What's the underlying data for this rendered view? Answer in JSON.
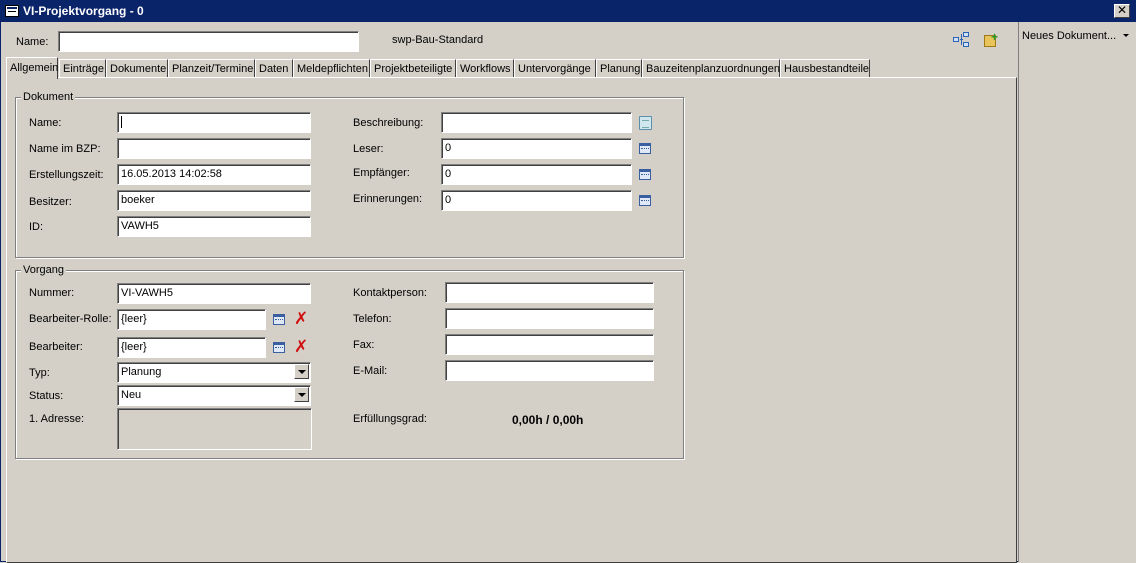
{
  "window": {
    "title": "VI-Projektvorgang - 0",
    "close_glyph": "✕"
  },
  "header": {
    "name_label": "Name:",
    "name_value": "",
    "template_text": "swp-Bau-Standard"
  },
  "toolbar": {
    "icons": [
      "structure-tree-icon",
      "folder-add-icon"
    ]
  },
  "side_panel": {
    "dropdown_label": "Neues Dokument..."
  },
  "tabs": [
    {
      "label": "Allgemein",
      "active": true
    },
    {
      "label": "Einträge"
    },
    {
      "label": "Dokumente"
    },
    {
      "label": "Planzeit/Termine"
    },
    {
      "label": "Daten"
    },
    {
      "label": "Meldepflichten"
    },
    {
      "label": "Projektbeteiligte"
    },
    {
      "label": "Workflows"
    },
    {
      "label": "Untervorgänge"
    },
    {
      "label": "Planung"
    },
    {
      "label": "Bauzeitenplanzuordnungen"
    },
    {
      "label": "Hausbestandteile"
    }
  ],
  "dokument": {
    "title": "Dokument",
    "name": {
      "label": "Name:",
      "value": ""
    },
    "name_bzp": {
      "label": "Name im BZP:",
      "value": ""
    },
    "erstellungszeit": {
      "label": "Erstellungszeit:",
      "value": "16.05.2013 14:02:58"
    },
    "besitzer": {
      "label": "Besitzer:",
      "value": "boeker"
    },
    "id": {
      "label": "ID:",
      "value": "VAWH5"
    },
    "beschreibung": {
      "label": "Beschreibung:",
      "value": ""
    },
    "leser": {
      "label": "Leser:",
      "value": "0"
    },
    "empfaenger": {
      "label": "Empfänger:",
      "value": "0"
    },
    "erinnerungen": {
      "label": "Erinnerungen:",
      "value": "0"
    }
  },
  "vorgang": {
    "title": "Vorgang",
    "nummer": {
      "label": "Nummer:",
      "value": "VI-VAWH5"
    },
    "bearbeiter_rolle": {
      "label": "Bearbeiter-Rolle:",
      "value": "{leer}"
    },
    "bearbeiter": {
      "label": "Bearbeiter:",
      "value": "{leer}"
    },
    "typ": {
      "label": "Typ:",
      "value": "Planung"
    },
    "status": {
      "label": "Status:",
      "value": "Neu"
    },
    "adresse": {
      "label": "1. Adresse:",
      "value": ""
    },
    "kontaktperson": {
      "label": "Kontaktperson:",
      "value": ""
    },
    "telefon": {
      "label": "Telefon:",
      "value": ""
    },
    "fax": {
      "label": "Fax:",
      "value": ""
    },
    "email": {
      "label": "E-Mail:",
      "value": ""
    },
    "erfuellungsgrad": {
      "label": "Erfüllungsgrad:",
      "value": "0,00h / 0,00h"
    }
  }
}
